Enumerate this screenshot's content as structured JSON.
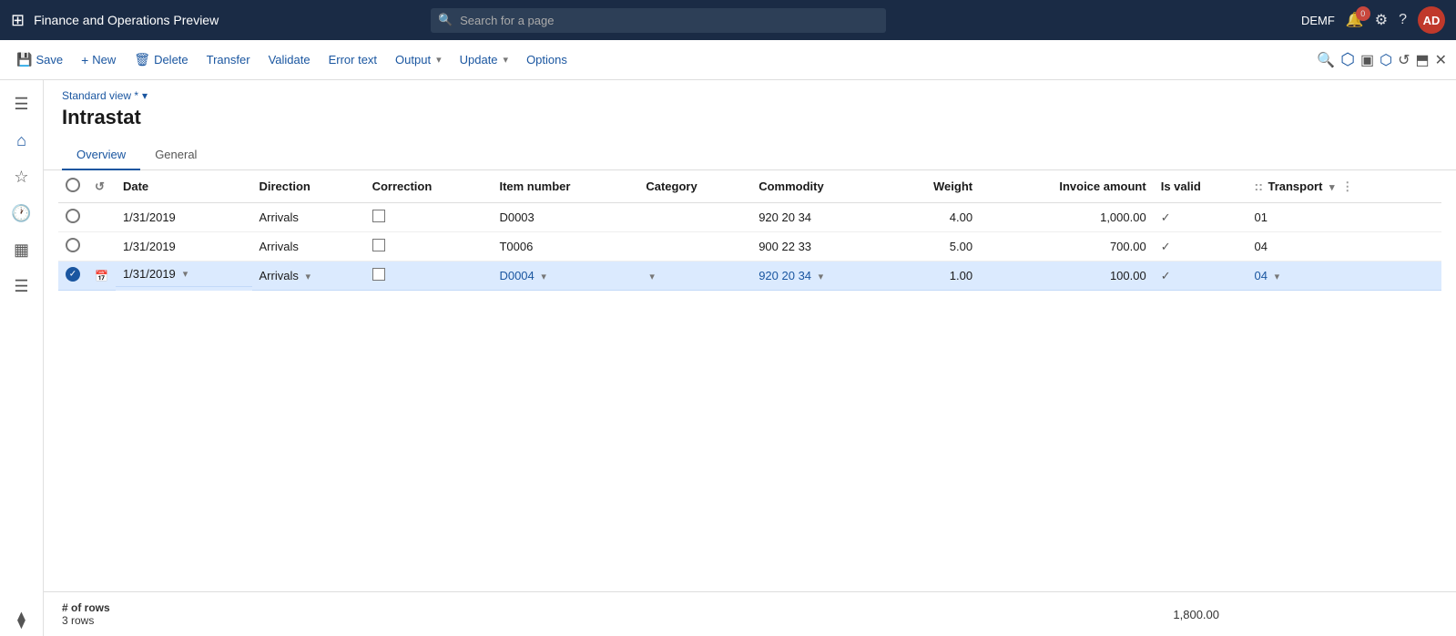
{
  "app": {
    "title": "Finance and Operations Preview"
  },
  "topbar": {
    "search_placeholder": "Search for a page",
    "company": "DEMF",
    "user_initials": "AD",
    "notification_count": "0"
  },
  "toolbar": {
    "save_label": "Save",
    "new_label": "New",
    "delete_label": "Delete",
    "transfer_label": "Transfer",
    "validate_label": "Validate",
    "error_text_label": "Error text",
    "output_label": "Output",
    "update_label": "Update",
    "options_label": "Options"
  },
  "page": {
    "view_label": "Standard view *",
    "title": "Intrastat",
    "tabs": [
      {
        "id": "overview",
        "label": "Overview",
        "active": true
      },
      {
        "id": "general",
        "label": "General",
        "active": false
      }
    ]
  },
  "table": {
    "columns": [
      {
        "id": "date",
        "label": "Date"
      },
      {
        "id": "direction",
        "label": "Direction"
      },
      {
        "id": "correction",
        "label": "Correction"
      },
      {
        "id": "item_number",
        "label": "Item number"
      },
      {
        "id": "category",
        "label": "Category"
      },
      {
        "id": "commodity",
        "label": "Commodity"
      },
      {
        "id": "weight",
        "label": "Weight"
      },
      {
        "id": "invoice_amount",
        "label": "Invoice amount"
      },
      {
        "id": "is_valid",
        "label": "Is valid"
      },
      {
        "id": "transport",
        "label": "Transport"
      }
    ],
    "rows": [
      {
        "id": 1,
        "date": "1/31/2019",
        "direction": "Arrivals",
        "correction": false,
        "item_number": "D0003",
        "category": "",
        "commodity": "920 20 34",
        "weight": "4.00",
        "invoice_amount": "1,000.00",
        "is_valid": true,
        "transport": "01",
        "selected": false
      },
      {
        "id": 2,
        "date": "1/31/2019",
        "direction": "Arrivals",
        "correction": false,
        "item_number": "T0006",
        "category": "",
        "commodity": "900 22 33",
        "weight": "5.00",
        "invoice_amount": "700.00",
        "is_valid": true,
        "transport": "04",
        "selected": false
      },
      {
        "id": 3,
        "date": "1/31/2019",
        "direction": "Arrivals",
        "correction": false,
        "item_number": "D0004",
        "category": "",
        "commodity": "920 20 34",
        "weight": "1.00",
        "invoice_amount": "100.00",
        "is_valid": true,
        "transport": "04",
        "selected": true,
        "editing": true
      }
    ]
  },
  "footer": {
    "rows_label": "# of rows",
    "rows_count": "3 rows",
    "total_value": "1,800.00"
  }
}
